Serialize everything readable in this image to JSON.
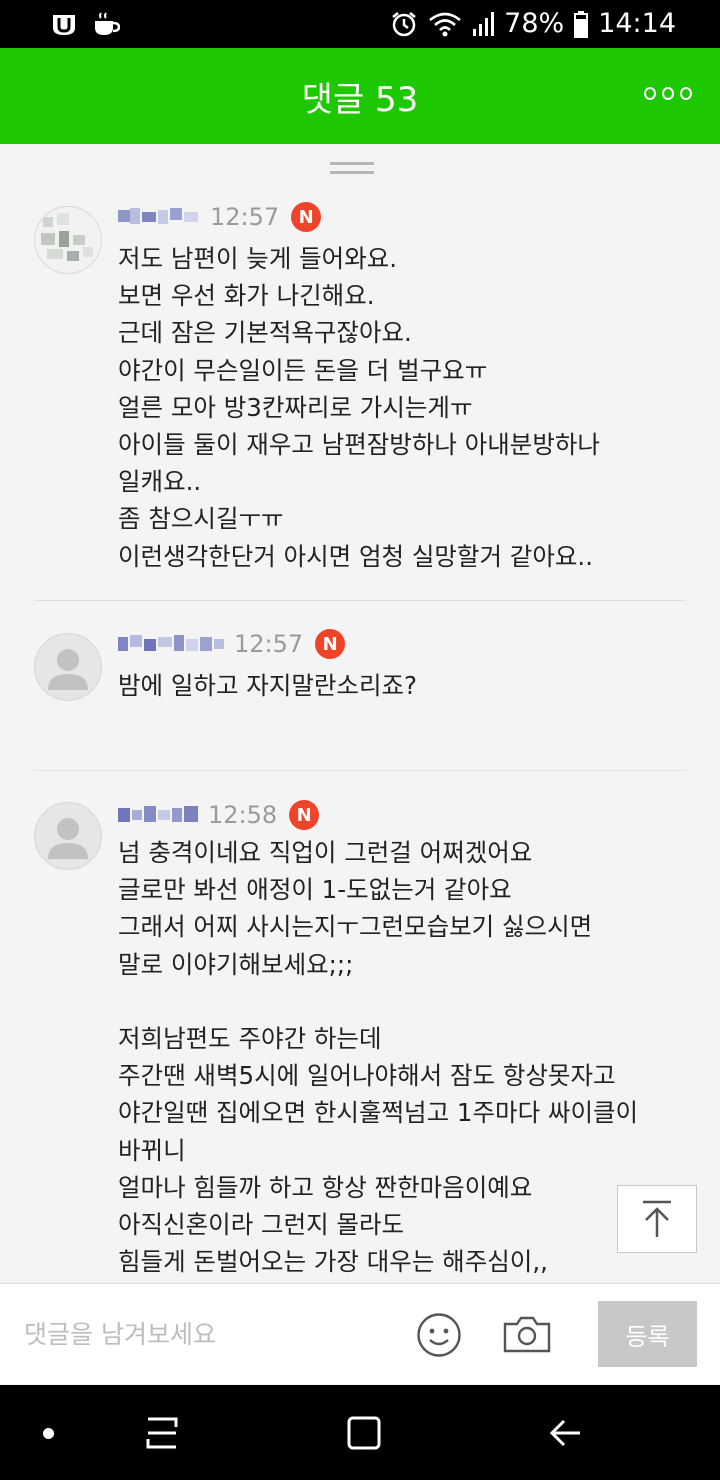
{
  "status_bar": {
    "battery": "78%",
    "time": "14:14",
    "icons": [
      "u-app-icon",
      "coffee-app-icon",
      "alarm-icon",
      "wifi-icon",
      "signal-icon",
      "battery-icon"
    ]
  },
  "header": {
    "title": "댓글 53",
    "more_icon": "more-dots-icon"
  },
  "comments": [
    {
      "time": "12:57",
      "badge": "N",
      "text": "저도 남편이 늦게 들어와요.\n보면 우선 화가 나긴해요.\n근데 잠은 기본적욕구잖아요.\n야간이 무슨일이든 돈을 더 벌구요ㅠ\n얼른 모아 방3칸짜리로 가시는게ㅠ\n아이들 둘이 재우고 남편잠방하나 아내분방하나\n일캐요..\n좀 참으시길ㅜㅠ\n이런생각한단거 아시면 엄청 실망할거 같아요.."
    },
    {
      "time": "12:57",
      "badge": "N",
      "text": "밤에 일하고 자지말란소리죠?"
    },
    {
      "time": "12:58",
      "badge": "N",
      "text": "넘 충격이네요 직업이 그런걸 어쩌겠어요\n글로만 봐선 애정이 1-도없는거 같아요\n그래서 어찌 사시는지ㅜ그런모습보기 싫으시면\n말로 이야기해보세요;;;\n\n저희남편도 주야간 하는데\n주간땐 새벽5시에 일어나야해서 잠도 항상못자고\n야간일땐 집에오면 한시훌쩍넘고 1주마다 싸이클이\n바뀌니\n얼마나 힘들까 하고 항상 짠한마음이예요\n아직신혼이라 그런지 몰라도\n힘들게 돈벌어오는 가장 대우는 해주심이,,"
    }
  ],
  "input_bar": {
    "placeholder": "댓글을 남겨보세요",
    "submit_label": "등록"
  },
  "nav_bar": {
    "buttons": [
      "recents-icon",
      "home-icon",
      "back-icon"
    ]
  },
  "colors": {
    "brand_green": "#1ec800",
    "badge_red": "#f0442a"
  }
}
